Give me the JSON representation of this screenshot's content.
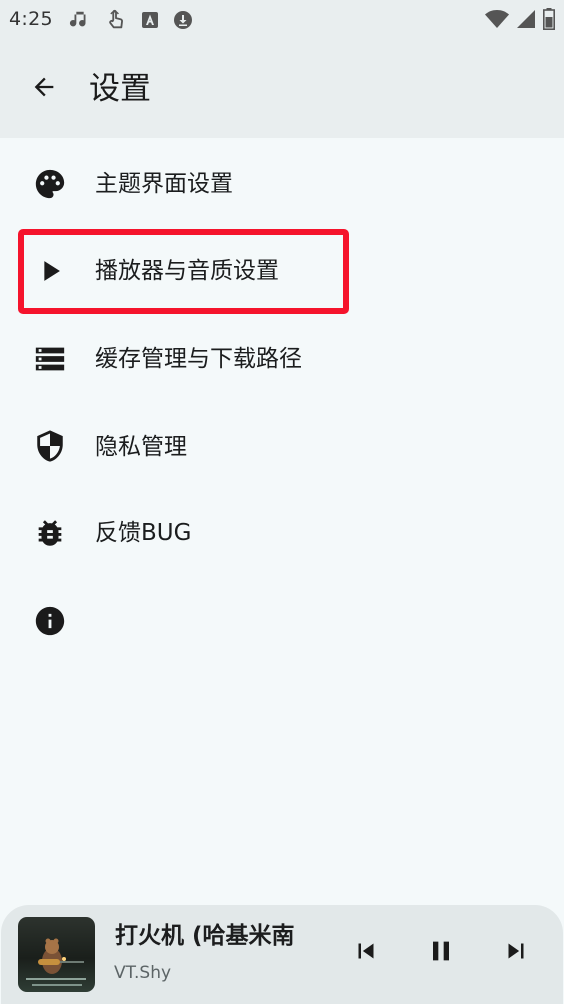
{
  "status_bar": {
    "time": "4:25",
    "left_icons": [
      "music-note-icon",
      "touch-hand-icon",
      "a-letter-icon",
      "download-icon"
    ],
    "right_icons": [
      "wifi-icon",
      "signal-icon",
      "battery-icon"
    ]
  },
  "app_bar": {
    "back_icon": "arrow-left-icon",
    "title": "设置"
  },
  "menu": {
    "items": [
      {
        "icon": "palette-icon",
        "label": "主题界面设置"
      },
      {
        "icon": "play-icon",
        "label": "播放器与音质设置"
      },
      {
        "icon": "storage-icon",
        "label": "缓存管理与下载路径"
      },
      {
        "icon": "shield-icon",
        "label": "隐私管理"
      },
      {
        "icon": "bug-icon",
        "label": "反馈BUG"
      },
      {
        "icon": "info-icon",
        "label": ""
      }
    ]
  },
  "highlight": {
    "color": "#f5142c"
  },
  "player": {
    "title": "打火机 (哈基米南",
    "artist": "VT.Shy",
    "controls": [
      "skip-previous-icon",
      "pause-icon",
      "skip-next-icon"
    ]
  },
  "colors": {
    "background": "#f4f9fa",
    "app_bar": "#e9eeef",
    "player_bar": "#e2e8e9"
  }
}
